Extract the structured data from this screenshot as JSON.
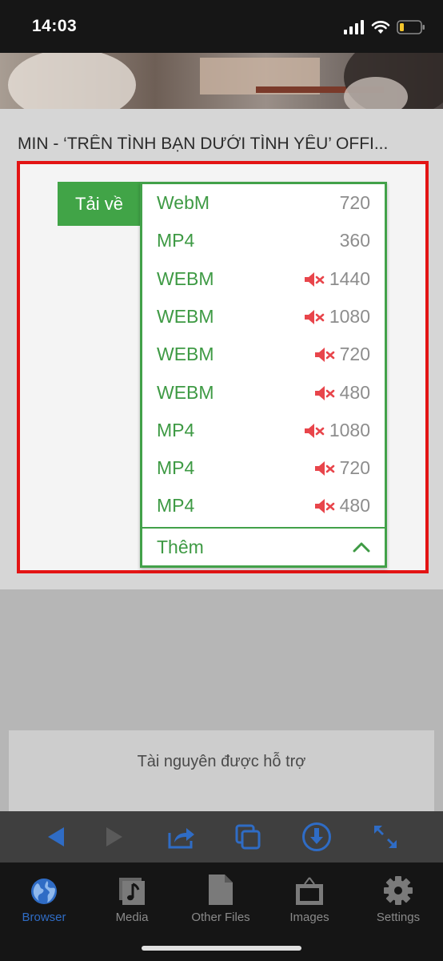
{
  "status_bar": {
    "time": "14:03"
  },
  "video_title": "MIN - ‘TRÊN TÌNH BẠN DƯỚI TÌNH YÊU’ OFFI...",
  "download_button": "Tải về",
  "formats": [
    {
      "format": "WebM",
      "resolution": "720",
      "muted": false
    },
    {
      "format": "MP4",
      "resolution": "360",
      "muted": false
    },
    {
      "format": "WEBM",
      "resolution": "1440",
      "muted": true
    },
    {
      "format": "WEBM",
      "resolution": "1080",
      "muted": true
    },
    {
      "format": "WEBM",
      "resolution": "720",
      "muted": true
    },
    {
      "format": "WEBM",
      "resolution": "480",
      "muted": true
    },
    {
      "format": "MP4",
      "resolution": "1080",
      "muted": true
    },
    {
      "format": "MP4",
      "resolution": "720",
      "muted": true
    },
    {
      "format": "MP4",
      "resolution": "480",
      "muted": true
    }
  ],
  "more_label": "Thêm",
  "resources_label": "Tài nguyên được hỗ trợ",
  "tabs": [
    {
      "label": "Browser",
      "icon": "globe-icon",
      "active": true
    },
    {
      "label": "Media",
      "icon": "music-note-icon",
      "active": false
    },
    {
      "label": "Other Files",
      "icon": "file-icon",
      "active": false
    },
    {
      "label": "Images",
      "icon": "image-frame-icon",
      "active": false
    },
    {
      "label": "Settings",
      "icon": "gear-icon",
      "active": false
    }
  ],
  "colors": {
    "accent_green": "#41a447",
    "highlight_red": "#e31414",
    "mute_red": "#e8454b",
    "toolbar_blue": "#2f6cc5"
  }
}
